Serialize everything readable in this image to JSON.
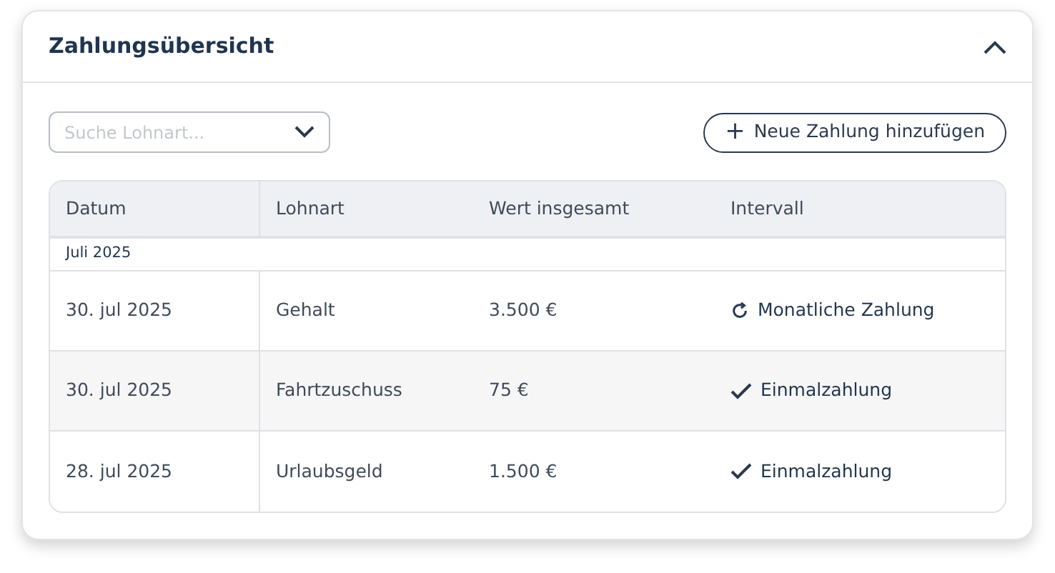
{
  "panel": {
    "title": "Zahlungsübersicht",
    "expanded": true
  },
  "search": {
    "placeholder": "Suche Lohnart..."
  },
  "add_button": {
    "icon": "+",
    "label": "Neue Zahlung hinzufügen"
  },
  "table": {
    "columns": [
      "Datum",
      "Lohnart",
      "Wert insgesamt",
      "Intervall"
    ],
    "group": "Juli 2025",
    "rows": [
      {
        "date": "30. jul 2025",
        "type": "Gehalt",
        "value": "3.500 €",
        "interval": "Monatliche Zahlung",
        "kind": "recurring"
      },
      {
        "date": "30. jul 2025",
        "type": "Fahrtzuschuss",
        "value": "75 €",
        "interval": "Einmalzahlung",
        "kind": "once"
      },
      {
        "date": "28. jul 2025",
        "type": "Urlaubsgeld",
        "value": "1.500 €",
        "interval": "Einmalzahlung",
        "kind": "once"
      }
    ]
  }
}
